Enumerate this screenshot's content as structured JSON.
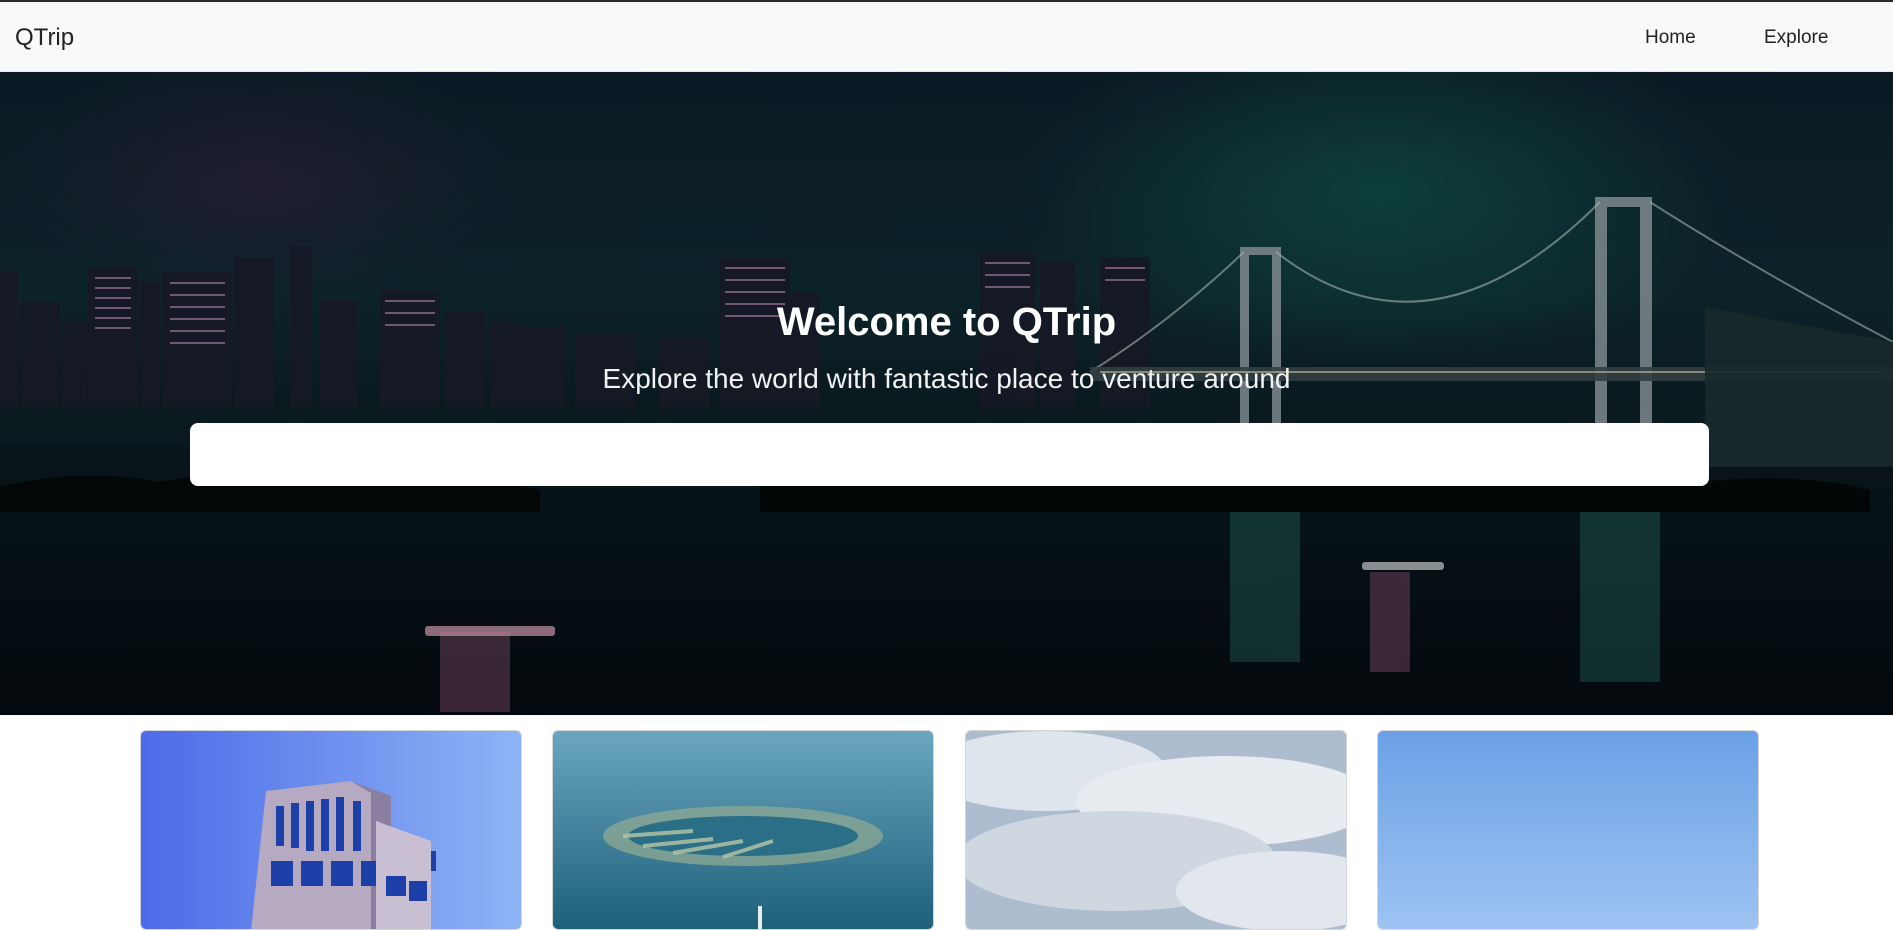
{
  "navbar": {
    "brand": "QTrip",
    "links": [
      {
        "label": "Home"
      },
      {
        "label": "Explore"
      }
    ]
  },
  "hero": {
    "title": "Welcome to QTrip",
    "subtitle": "Explore the world with fantastic place to venture around",
    "search": {
      "value": "",
      "placeholder": ""
    }
  },
  "cards": [
    {
      "subject": "office-tower"
    },
    {
      "subject": "palm-island"
    },
    {
      "subject": "cloudy-sky"
    },
    {
      "subject": "blue-sky"
    }
  ]
}
